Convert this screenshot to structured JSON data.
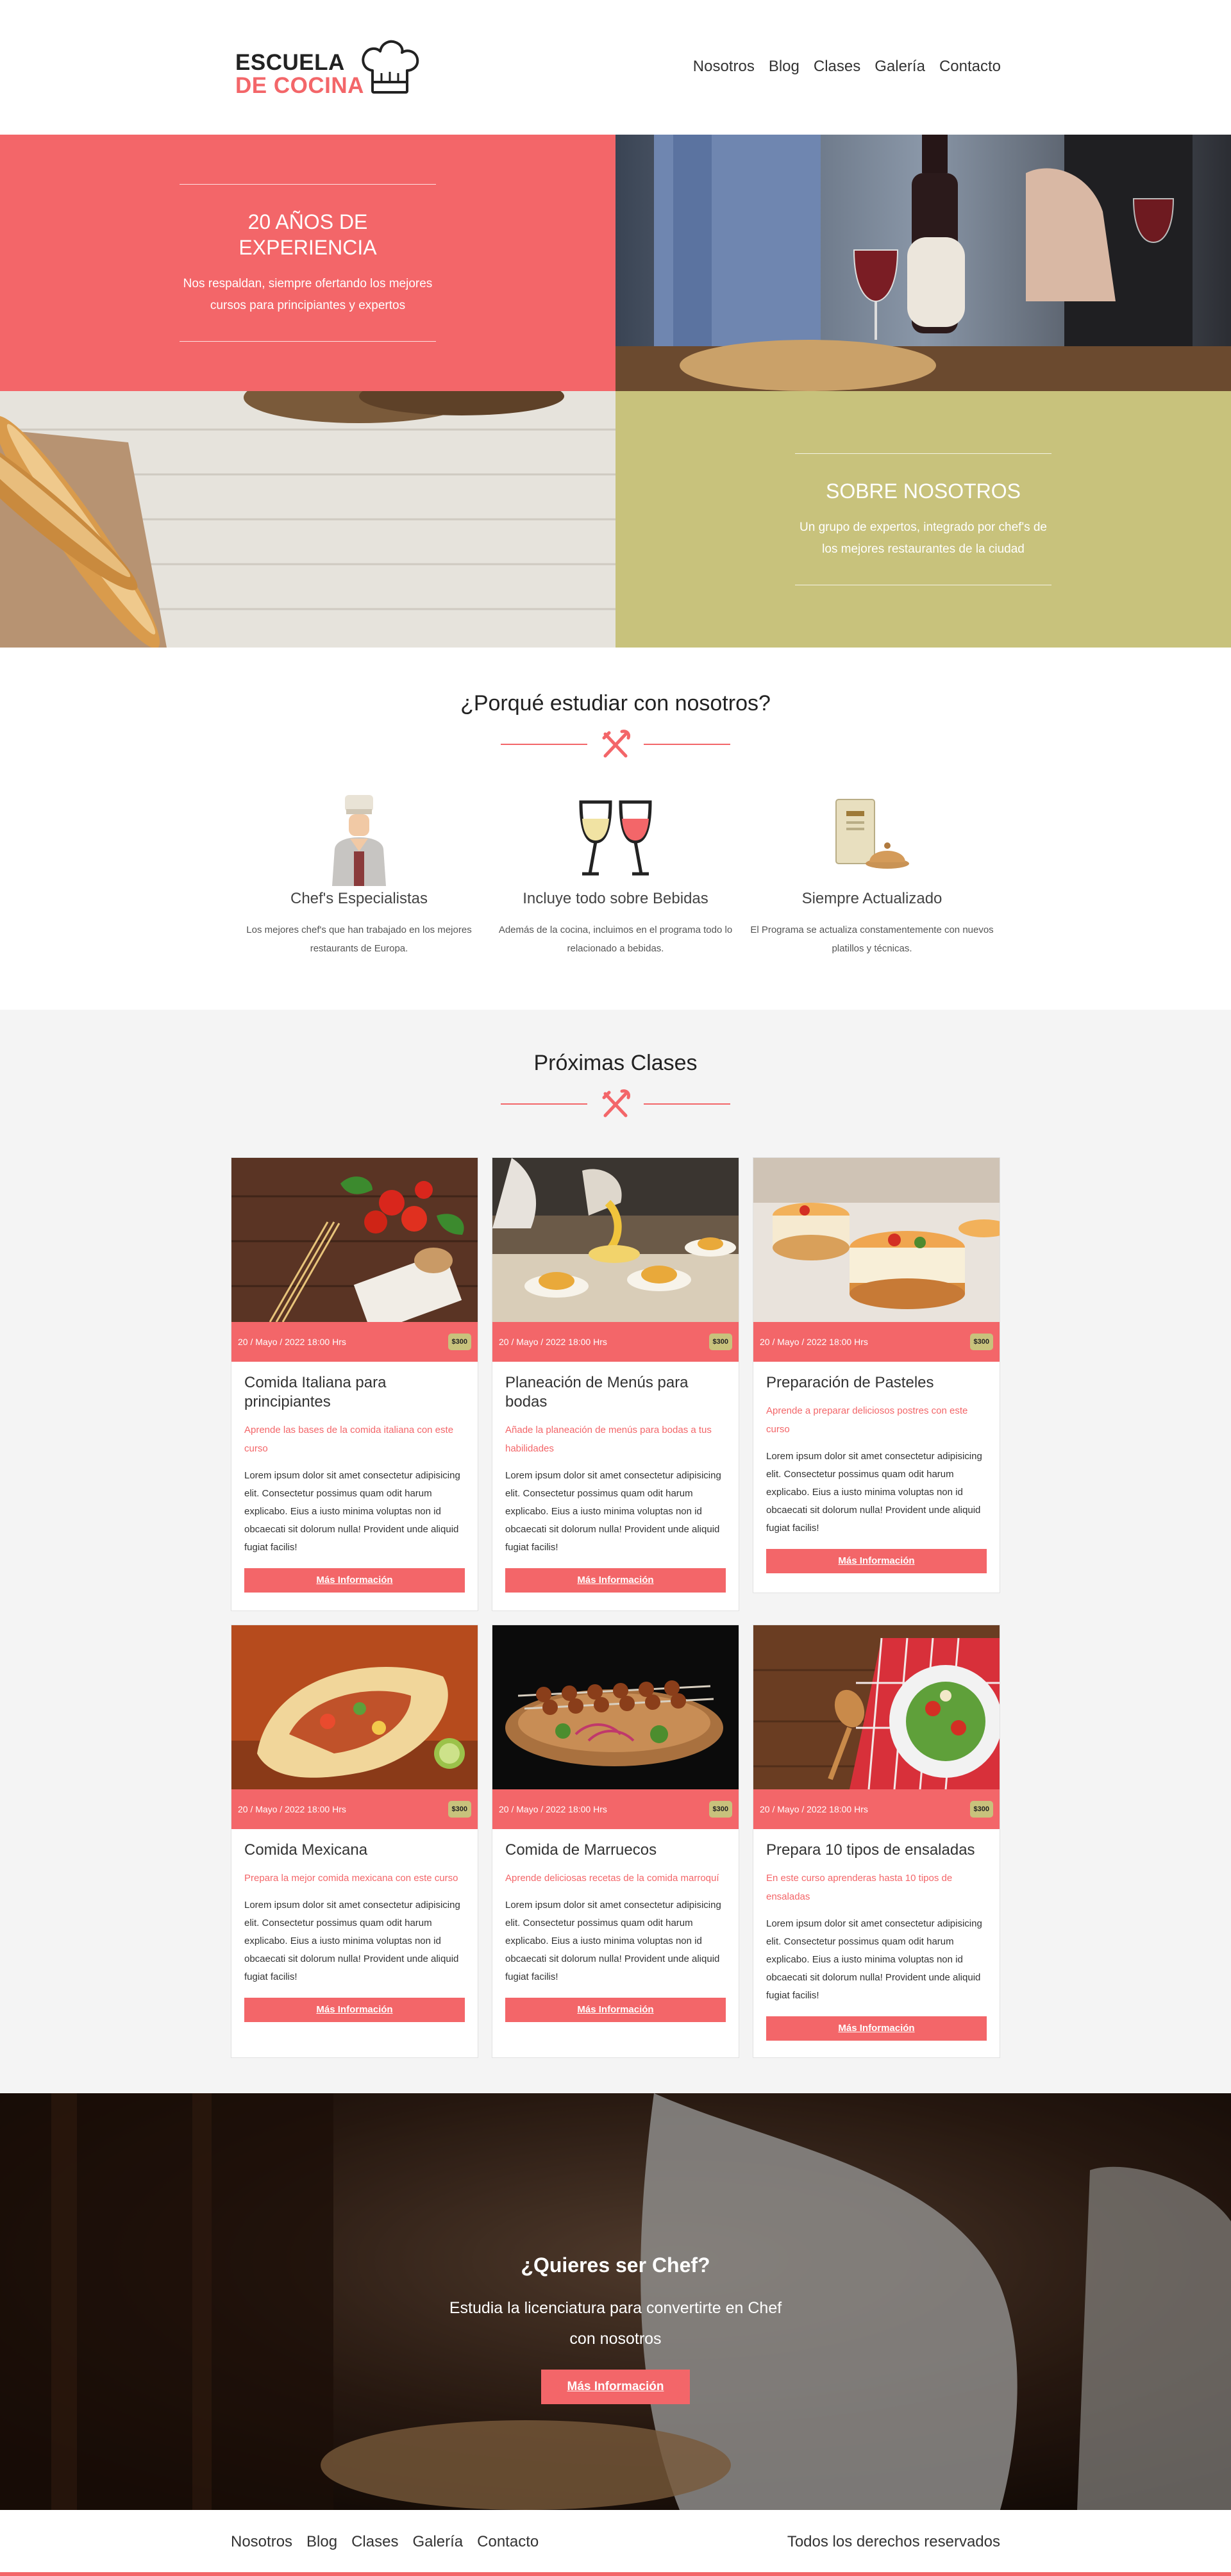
{
  "logo": {
    "line1": "ESCUELA",
    "line2": "DE COCINA",
    "icon": "chef-hat-icon"
  },
  "nav": [
    "Nosotros",
    "Blog",
    "Clases",
    "Galería",
    "Contacto"
  ],
  "hero": {
    "experience": {
      "title": "20 AÑOS DE EXPERIENCIA",
      "text": "Nos respaldan, siempre ofertando los mejores cursos para principiantes y expertos"
    },
    "about": {
      "title": "SOBRE NOSOTROS",
      "text": "Un grupo de expertos, integrado por chef's de los mejores restaurantes de la ciudad"
    }
  },
  "why": {
    "title": "¿Porqué estudiar con nosotros?",
    "features": [
      {
        "title": "Chef's Especialistas",
        "text": "Los mejores chef's que han trabajado en los mejores restaurants de Europa.",
        "icon": "chef-icon"
      },
      {
        "title": "Incluye todo sobre Bebidas",
        "text": "Además de la cocina, incluimos en el programa todo lo relacionado a bebidas.",
        "icon": "wine-glasses-icon"
      },
      {
        "title": "Siempre Actualizado",
        "text": "El Programa se actualiza constamentemente con nuevos platillos y técnicas.",
        "icon": "menu-dish-icon"
      }
    ]
  },
  "classes": {
    "title": "Próximas Clases",
    "items": [
      {
        "date": "20 / Mayo / 2022 18:00 Hrs",
        "price": "$300",
        "title": "Comida Italiana para principiantes",
        "subtitle": "Aprende las bases de la comida italiana con este curso",
        "text": "Lorem ipsum dolor sit amet consectetur adipisicing elit. Consectetur possimus quam odit harum explicabo. Eius a iusto minima voluptas non id obcaecati sit dolorum nulla! Provident unde aliquid fugiat facilis!",
        "button": "Más Información"
      },
      {
        "date": "20 / Mayo / 2022 18:00 Hrs",
        "price": "$300",
        "title": "Planeación de Menús para bodas",
        "subtitle": "Añade la planeación de menús para bodas a tus habilidades",
        "text": "Lorem ipsum dolor sit amet consectetur adipisicing elit. Consectetur possimus quam odit harum explicabo. Eius a iusto minima voluptas non id obcaecati sit dolorum nulla! Provident unde aliquid fugiat facilis!",
        "button": "Más Información"
      },
      {
        "date": "20 / Mayo / 2022 18:00 Hrs",
        "price": "$300",
        "title": "Preparación de Pasteles",
        "subtitle": "Aprende a preparar deliciosos postres con este curso",
        "text": "Lorem ipsum dolor sit amet consectetur adipisicing elit. Consectetur possimus quam odit harum explicabo. Eius a iusto minima voluptas non id obcaecati sit dolorum nulla! Provident unde aliquid fugiat facilis!",
        "button": "Más Información"
      },
      {
        "date": "20 / Mayo / 2022 18:00 Hrs",
        "price": "$300",
        "title": "Comida Mexicana",
        "subtitle": "Prepara la mejor comida mexicana con este curso",
        "text": "Lorem ipsum dolor sit amet consectetur adipisicing elit. Consectetur possimus quam odit harum explicabo. Eius a iusto minima voluptas non id obcaecati sit dolorum nulla! Provident unde aliquid fugiat facilis!",
        "button": "Más Información"
      },
      {
        "date": "20 / Mayo / 2022 18:00 Hrs",
        "price": "$300",
        "title": "Comida de Marruecos",
        "subtitle": "Aprende deliciosas recetas de la comida marroquí",
        "text": "Lorem ipsum dolor sit amet consectetur adipisicing elit. Consectetur possimus quam odit harum explicabo. Eius a iusto minima voluptas non id obcaecati sit dolorum nulla! Provident unde aliquid fugiat facilis!",
        "button": "Más Información"
      },
      {
        "date": "20 / Mayo / 2022 18:00 Hrs",
        "price": "$300",
        "title": "Prepara 10 tipos de ensaladas",
        "subtitle": "En este curso aprenderas hasta 10 tipos de ensaladas",
        "text": "Lorem ipsum dolor sit amet consectetur adipisicing elit. Consectetur possimus quam odit harum explicabo. Eius a iusto minima voluptas non id obcaecati sit dolorum nulla! Provident unde aliquid fugiat facilis!",
        "button": "Más Información"
      }
    ]
  },
  "cta": {
    "title": "¿Quieres ser Chef?",
    "text": "Estudia la licenciatura para convertirte en Chef con nosotros",
    "button": "Más Información"
  },
  "footer": {
    "nav": [
      "Nosotros",
      "Blog",
      "Clases",
      "Galería",
      "Contacto"
    ],
    "copyright": "Todos los derechos reservados"
  },
  "colors": {
    "accent": "#f36669",
    "olive": "#c8c27c",
    "section_bg": "#f4f4f4"
  }
}
